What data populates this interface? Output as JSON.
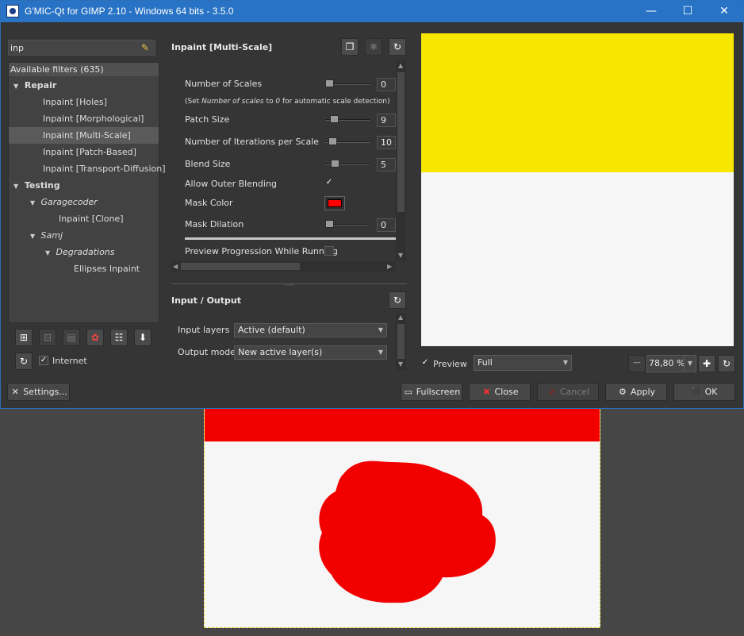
{
  "window": {
    "title": "G'MIC-Qt for GIMP 2.10 - Windows 64 bits - 3.5.0",
    "minimize": "—",
    "maximize": "☐",
    "close": "✕"
  },
  "search": {
    "value": "inp"
  },
  "filters": {
    "header": "Available filters (635)",
    "tree": [
      {
        "label": "Repair"
      },
      {
        "label": "Inpaint [Holes]"
      },
      {
        "label": "Inpaint [Morphological]"
      },
      {
        "label": "Inpaint [Multi-Scale]"
      },
      {
        "label": "Inpaint [Patch-Based]"
      },
      {
        "label": "Inpaint [Transport-Diffusion]"
      },
      {
        "label": "Testing"
      },
      {
        "label": "Garagecoder"
      },
      {
        "label": "Inpaint [Clone]"
      },
      {
        "label": "Samj"
      },
      {
        "label": "Degradations"
      },
      {
        "label": "Ellipses Inpaint"
      }
    ],
    "internet_label": "Internet",
    "internet_checked": true
  },
  "filter": {
    "title": "Inpaint [Multi-Scale]",
    "params": {
      "scales_label": "Number of Scales",
      "scales_value": "0",
      "note_prefix": "(Set ",
      "note_em1": "Number of scales",
      "note_mid": " to ",
      "note_em2": "0",
      "note_suffix": " for automatic scale detection)",
      "patch_label": "Patch Size",
      "patch_value": "9",
      "iterations_label": "Number of Iterations per Scale",
      "iterations_value": "10",
      "blend_label": "Blend Size",
      "blend_value": "5",
      "outer_label": "Allow Outer Blending",
      "mask_color_label": "Mask Color",
      "mask_color": "#ff0000",
      "dilation_label": "Mask Dilation",
      "dilation_value": "0",
      "progression_label": "Preview Progression While Running"
    }
  },
  "io": {
    "title": "Input / Output",
    "input_label": "Input layers",
    "input_value": "Active (default)",
    "output_label": "Output mode",
    "output_value": "New active layer(s)"
  },
  "preview": {
    "label": "Preview",
    "mode": "Full",
    "zoom": "78,80 %"
  },
  "buttons": {
    "settings": "Settings...",
    "fullscreen": "Fullscreen",
    "close": "Close",
    "cancel": "Cancel",
    "apply": "Apply",
    "ok": "OK"
  },
  "colors": {
    "titlebar": "#2873c5",
    "preview_yellow": "#f6e600",
    "mask_red": "#f20000"
  }
}
